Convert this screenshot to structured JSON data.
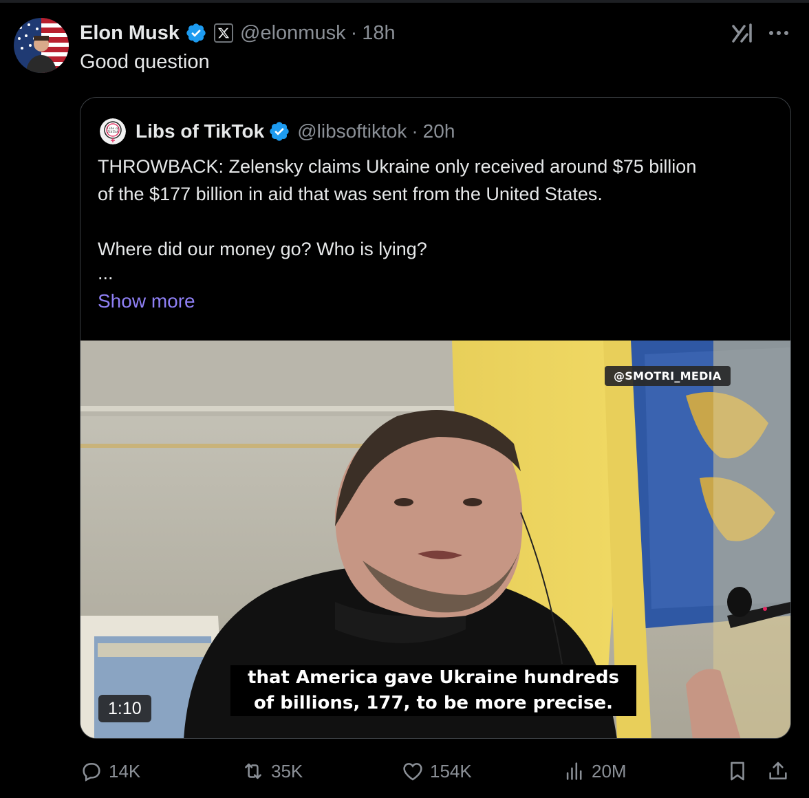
{
  "post": {
    "author_name": "Elon Musk",
    "handle": "@elonmusk",
    "separator": "·",
    "time": "18h",
    "text": "Good question",
    "affiliation_badge": "X",
    "icons": {
      "verified": "verified-badge-icon",
      "affiliation": "x-logo-icon",
      "grok": "grok-icon",
      "more": "more-dots-icon"
    }
  },
  "quote": {
    "author_name": "Libs of TikTok",
    "handle": "@libsoftiktok",
    "separator": "·",
    "time": "20h",
    "body_lines": [
      "THROWBACK: Zelensky claims Ukraine only received around $75 billion",
      "of the $177 billion in aid that was sent from the United States."
    ],
    "body_line_3": "Where did our money go? Who is lying?",
    "ellipsis": "...",
    "show_more": "Show more",
    "avatar_text": "Libs of TikTok",
    "media": {
      "watermark": "@SMOTRI_MEDIA",
      "subtitle_line_1": "that America gave Ukraine hundreds",
      "subtitle_line_2": "of billions, 177, to be more precise.",
      "duration": "1:10"
    }
  },
  "actions": {
    "replies": "14K",
    "reposts": "35K",
    "likes": "154K",
    "views": "20M"
  },
  "colors": {
    "background": "#000000",
    "text": "#e7e9ea",
    "muted": "#8b9097",
    "link": "#8f80f5",
    "verified": "#1d9bf0"
  }
}
